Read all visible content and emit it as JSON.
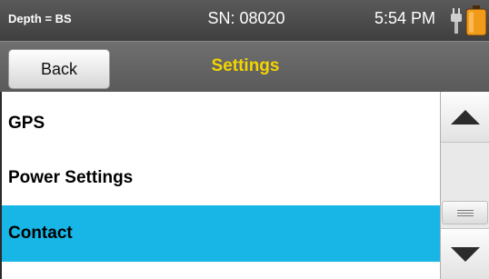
{
  "status_bar": {
    "depth_label": "Depth = BS",
    "serial": "SN: 08020",
    "time": "5:54 PM",
    "plug_icon": "power-plug-icon",
    "battery_icon": "battery-icon",
    "battery_color": "#f29a1a"
  },
  "header": {
    "back_label": "Back",
    "title": "Settings",
    "title_color": "#f4d400"
  },
  "settings_list": {
    "items": [
      {
        "label": "GPS",
        "selected": false
      },
      {
        "label": "Power Settings",
        "selected": false
      },
      {
        "label": "Contact",
        "selected": true
      }
    ],
    "selection_color": "#17b6e6"
  },
  "scrollbar": {
    "up_icon": "triangle-up-icon",
    "down_icon": "triangle-down-icon",
    "thumb_icon": "grip-lines-icon"
  }
}
